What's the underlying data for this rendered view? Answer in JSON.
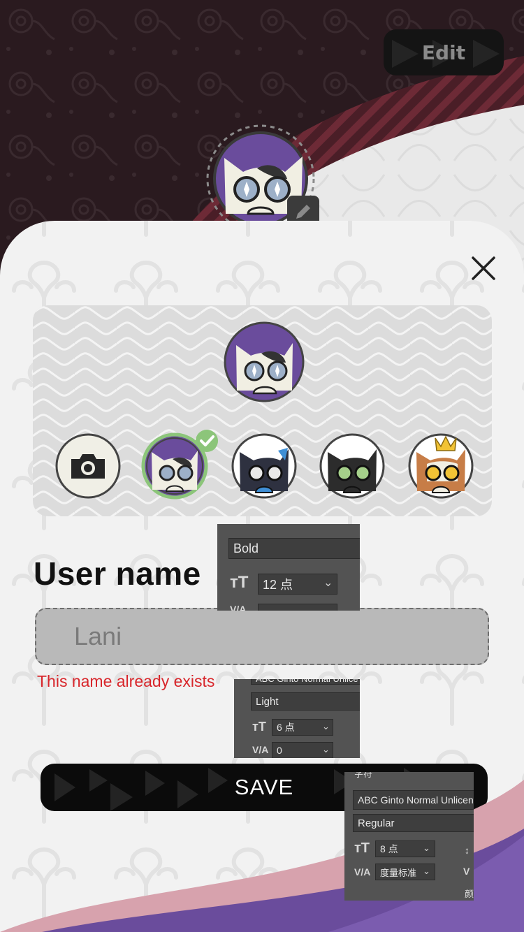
{
  "header": {
    "edit_label": "Edit",
    "background_colors": {
      "dark": "#2a1a1f",
      "stripe": "#6d2a36",
      "light": "#e9e9e9"
    }
  },
  "modal": {
    "close_icon": "close-icon",
    "preview_avatar": "cat-avatar-purple",
    "avatar_options": [
      {
        "icon": "camera-icon"
      },
      {
        "icon": "cat-avatar-purple",
        "selected": true
      },
      {
        "icon": "cat-avatar-blue"
      },
      {
        "icon": "cat-avatar-black"
      },
      {
        "icon": "cat-avatar-orange-crown"
      }
    ],
    "username_label": "User name",
    "username_value": "Lani",
    "error_message": "This name already exists",
    "save_label": "SAVE",
    "colors": {
      "error": "#d8262b",
      "selected_ring": "#7fbf6a",
      "accent_purple": "#6a4c9c"
    }
  },
  "ps_overlays": {
    "panel1": {
      "weight": "Bold",
      "size": "12 点",
      "tracking_icon": "V/A"
    },
    "panel2": {
      "font": "ABC Ginto Normal Unlice",
      "weight": "Light",
      "size": "6 点",
      "tracking_icon": "V/A",
      "tracking": "0"
    },
    "panel3": {
      "header": "字符",
      "font": "ABC Ginto Normal Unlicense",
      "weight": "Regular",
      "size": "8 点",
      "tracking_icon": "V/A",
      "tracking": "度量标准",
      "color_label": "颜"
    }
  }
}
